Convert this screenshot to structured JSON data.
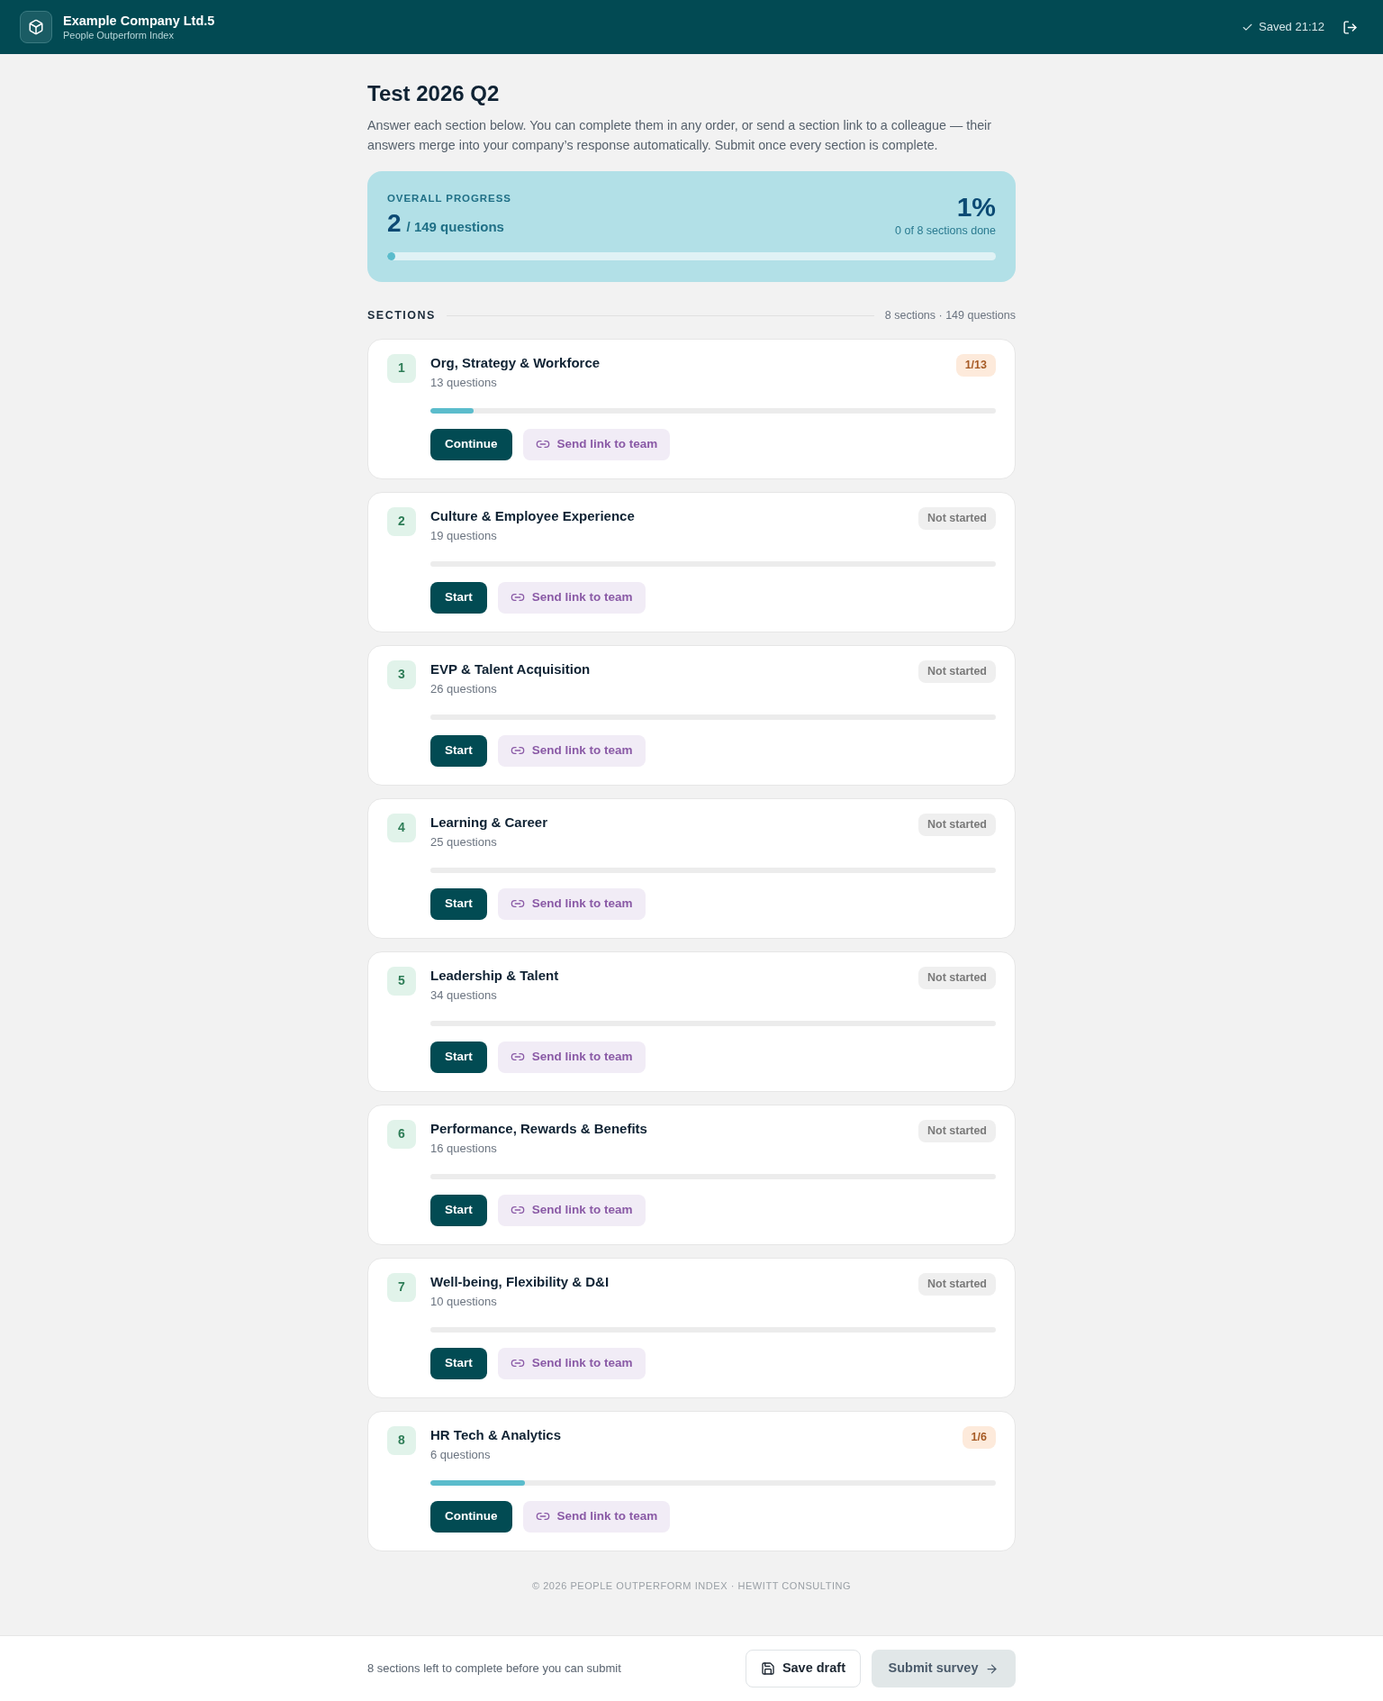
{
  "header": {
    "company": "Example Company Ltd.5",
    "product": "People Outperform Index",
    "saved_status": "Saved 21:12"
  },
  "page": {
    "title": "Test 2026 Q2",
    "intro": "Answer each section below. You can complete them in any order, or send a section link to a colleague — their answers merge into your company’s response automatically. Submit once every section is complete."
  },
  "overall_progress": {
    "label": "OVERALL PROGRESS",
    "answered": "2",
    "total": "/ 149 questions",
    "percent": "1%",
    "sections_done": "0 of 8 sections done",
    "level": 0.013
  },
  "sections_header": {
    "title": "SECTIONS",
    "summary": "8 sections · 149 questions"
  },
  "sections": [
    {
      "number": "1",
      "title": "Org, Strategy & Workforce",
      "questions": "13 questions",
      "status": "1/13",
      "kind": "in_progress",
      "level": 0.077,
      "primary_action": "Continue",
      "share_action": "Send link to team"
    },
    {
      "number": "2",
      "title": "Culture & Employee Experience",
      "questions": "19 questions",
      "status": "Not started",
      "kind": "not_started",
      "level": 0,
      "primary_action": "Start",
      "share_action": "Send link to team"
    },
    {
      "number": "3",
      "title": "EVP & Talent Acquisition",
      "questions": "26 questions",
      "status": "Not started",
      "kind": "not_started",
      "level": 0,
      "primary_action": "Start",
      "share_action": "Send link to team"
    },
    {
      "number": "4",
      "title": "Learning & Career",
      "questions": "25 questions",
      "status": "Not started",
      "kind": "not_started",
      "level": 0,
      "primary_action": "Start",
      "share_action": "Send link to team"
    },
    {
      "number": "5",
      "title": "Leadership & Talent",
      "questions": "34 questions",
      "status": "Not started",
      "kind": "not_started",
      "level": 0,
      "primary_action": "Start",
      "share_action": "Send link to team"
    },
    {
      "number": "6",
      "title": "Performance, Rewards & Benefits",
      "questions": "16 questions",
      "status": "Not started",
      "kind": "not_started",
      "level": 0,
      "primary_action": "Start",
      "share_action": "Send link to team"
    },
    {
      "number": "7",
      "title": "Well-being, Flexibility & D&I",
      "questions": "10 questions",
      "status": "Not started",
      "kind": "not_started",
      "level": 0,
      "primary_action": "Start",
      "share_action": "Send link to team"
    },
    {
      "number": "8",
      "title": "HR Tech & Analytics",
      "questions": "6 questions",
      "status": "1/6",
      "kind": "in_progress",
      "level": 0.167,
      "primary_action": "Continue",
      "share_action": "Send link to team"
    }
  ],
  "footer": {
    "copyright": "© 2026 PEOPLE OUTPERFORM INDEX · HEWITT CONSULTING"
  },
  "bottom_bar": {
    "message": "8 sections left to complete before you can submit",
    "save_button": "Save draft",
    "submit_button": {
      "label": "Submit survey",
      "disabled": true
    }
  }
}
